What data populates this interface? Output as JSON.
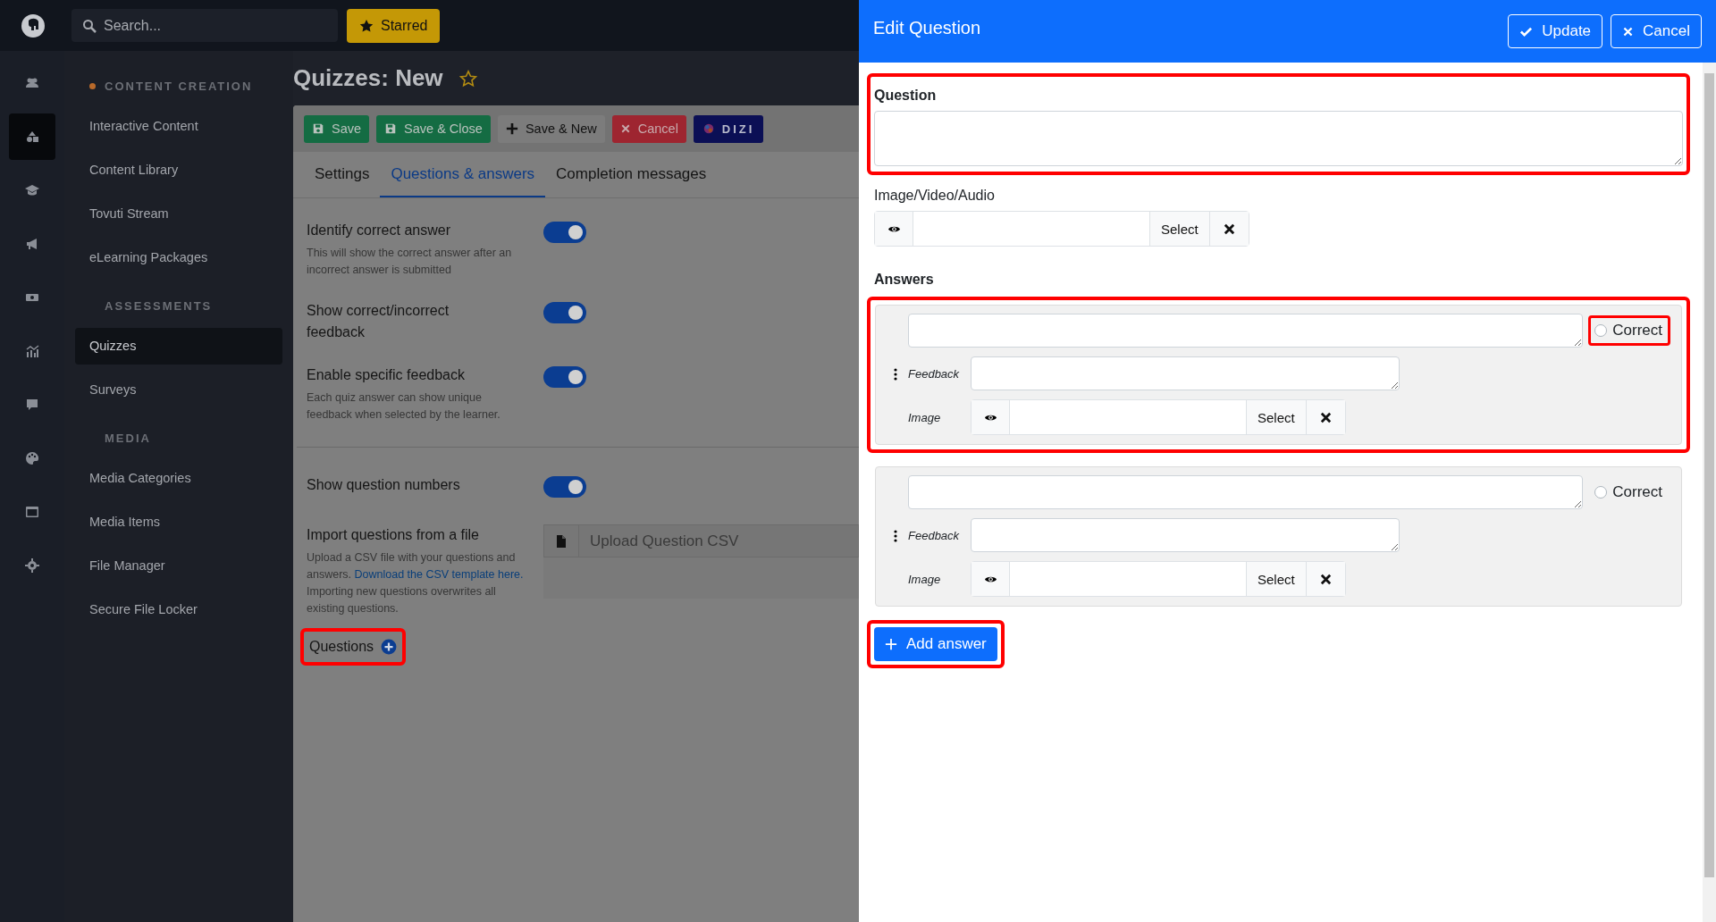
{
  "top_bar": {
    "search": {
      "placeholder": "Search..."
    },
    "starred_button": "Starred"
  },
  "rail": [
    {
      "selected": false
    },
    {
      "selected": true
    },
    {
      "selected": false
    },
    {
      "selected": false
    },
    {
      "selected": false
    },
    {
      "selected": false
    },
    {
      "selected": false
    },
    {
      "selected": false
    },
    {
      "selected": false
    },
    {
      "selected": false
    }
  ],
  "sidebar": {
    "sections": [
      {
        "title": "CONTENT CREATION",
        "active": true,
        "items": [
          {
            "label": "Interactive Content",
            "selected": false
          },
          {
            "label": "Content Library",
            "selected": false
          },
          {
            "label": "Tovuti Stream",
            "selected": false
          },
          {
            "label": "eLearning Packages",
            "selected": false
          }
        ]
      },
      {
        "title": "ASSESSMENTS",
        "active": false,
        "items": [
          {
            "label": "Quizzes",
            "selected": true
          },
          {
            "label": "Surveys",
            "selected": false
          }
        ]
      },
      {
        "title": "MEDIA",
        "active": false,
        "items": [
          {
            "label": "Media Categories",
            "selected": false
          },
          {
            "label": "Media Items",
            "selected": false
          },
          {
            "label": "File Manager",
            "selected": false
          },
          {
            "label": "Secure File Locker",
            "selected": false
          }
        ]
      }
    ]
  },
  "page": {
    "title": "Quizzes: New",
    "starred": false
  },
  "toolbar": [
    {
      "label": "Save",
      "kind": "save"
    },
    {
      "label": "Save & Close",
      "kind": "save"
    },
    {
      "label": "Save & New",
      "kind": "new"
    },
    {
      "label": "Cancel",
      "kind": "cancel"
    },
    {
      "label": "DIZI",
      "kind": "logo"
    }
  ],
  "tabs": [
    {
      "label": "Settings",
      "selected": false
    },
    {
      "label": "Questions & answers",
      "selected": true
    },
    {
      "label": "Completion messages",
      "selected": false
    }
  ],
  "settings": [
    {
      "items": [
        {
          "label": "Identify correct answer",
          "help": "This will show the correct answer after an incorrect answer is submitted",
          "on": true
        },
        {
          "label": "Show correct/incorrect feedback",
          "on": true
        },
        {
          "label": "Enable specific feedback",
          "help": "Each quiz answer can show unique feedback when selected by the learner.",
          "on": true
        }
      ]
    },
    {
      "items": [
        {
          "label": "Show question numbers",
          "on": true
        }
      ]
    }
  ],
  "import": {
    "label": "Import questions from a file",
    "help": "Upload a CSV file with your questions and answers.",
    "link": "Download the CSV template here.",
    "note": "Importing new questions overwrites all existing questions.",
    "upload": {
      "placeholder": "Upload Question CSV"
    }
  },
  "questions": {
    "label": "Questions",
    "highlighted": true
  },
  "edit_panel": {
    "title": "Edit Question",
    "buttons": [
      {
        "label": "Update",
        "kind": "update"
      },
      {
        "label": "Cancel",
        "kind": "cancel"
      }
    ],
    "question": {
      "label": "Question",
      "highlighted": true
    },
    "media": {
      "label": "Image/Video/Audio",
      "select": "Select"
    },
    "answers_label": "Answers",
    "answers": [
      {
        "correct_label": "Correct",
        "correct": false,
        "correct_highlighted": true,
        "feedback_label": "Feedback",
        "image_label": "Image",
        "select": "Select",
        "highlighted": true
      },
      {
        "correct_label": "Correct",
        "correct": false,
        "correct_highlighted": false,
        "feedback_label": "Feedback",
        "image_label": "Image",
        "select": "Select",
        "highlighted": false
      }
    ],
    "add_answer": {
      "label": "Add answer",
      "highlighted": true
    }
  }
}
